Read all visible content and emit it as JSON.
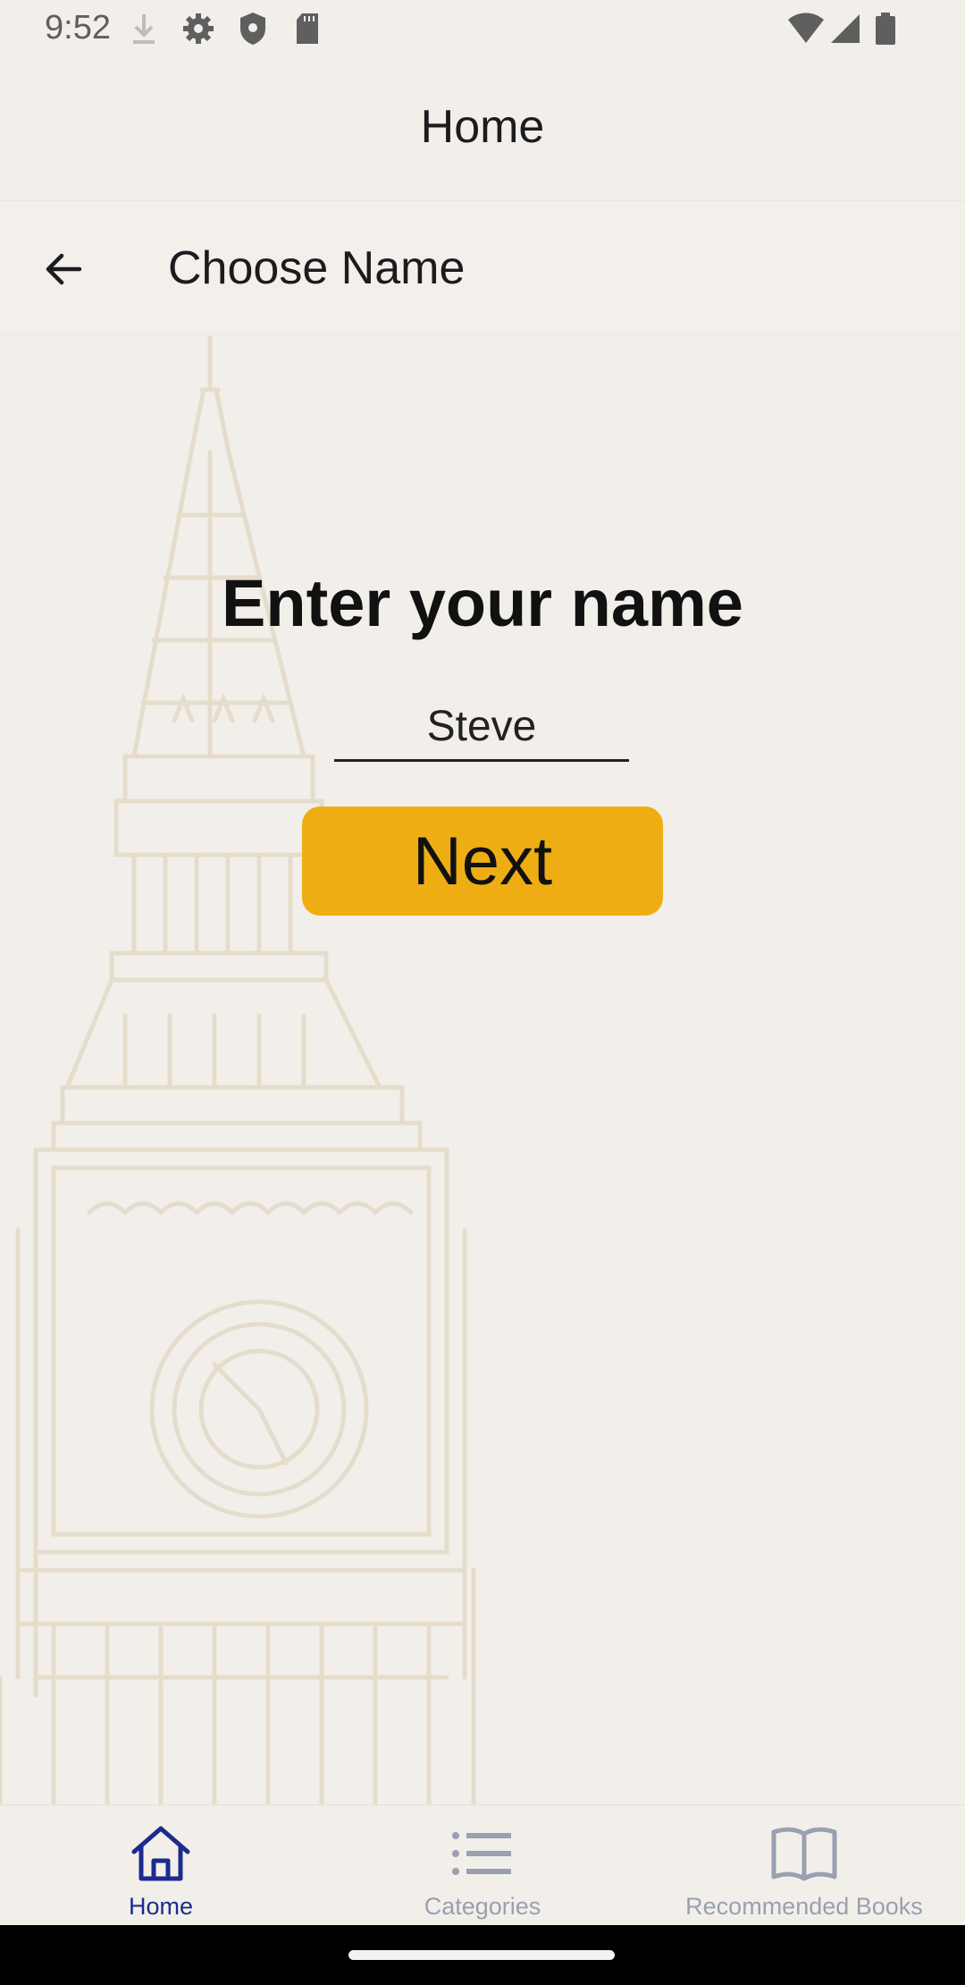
{
  "status_bar": {
    "time": "9:52",
    "icons": [
      "download-icon",
      "gear-icon",
      "shield-icon",
      "sd-card-icon",
      "wifi-icon",
      "signal-icon",
      "battery-icon"
    ]
  },
  "app_bar": {
    "title": "Home"
  },
  "sub_bar": {
    "back_icon": "arrow-back-icon",
    "title": "Choose Name"
  },
  "main": {
    "heading": "Enter your name",
    "name_field": {
      "value": "Steve"
    },
    "next_label": "Next"
  },
  "bottom_nav": {
    "items": [
      {
        "label": "Home",
        "icon": "home-icon",
        "active": true
      },
      {
        "label": "Categories",
        "icon": "list-icon",
        "active": false
      },
      {
        "label": "Recommended Books",
        "icon": "book-icon",
        "active": false
      }
    ]
  },
  "colors": {
    "background": "#f2efea",
    "accent_button": "#eeae13",
    "active_nav": "#1c2b8c",
    "inactive_nav": "#9aa0b0",
    "tower_sketch": "#e6dccb"
  }
}
